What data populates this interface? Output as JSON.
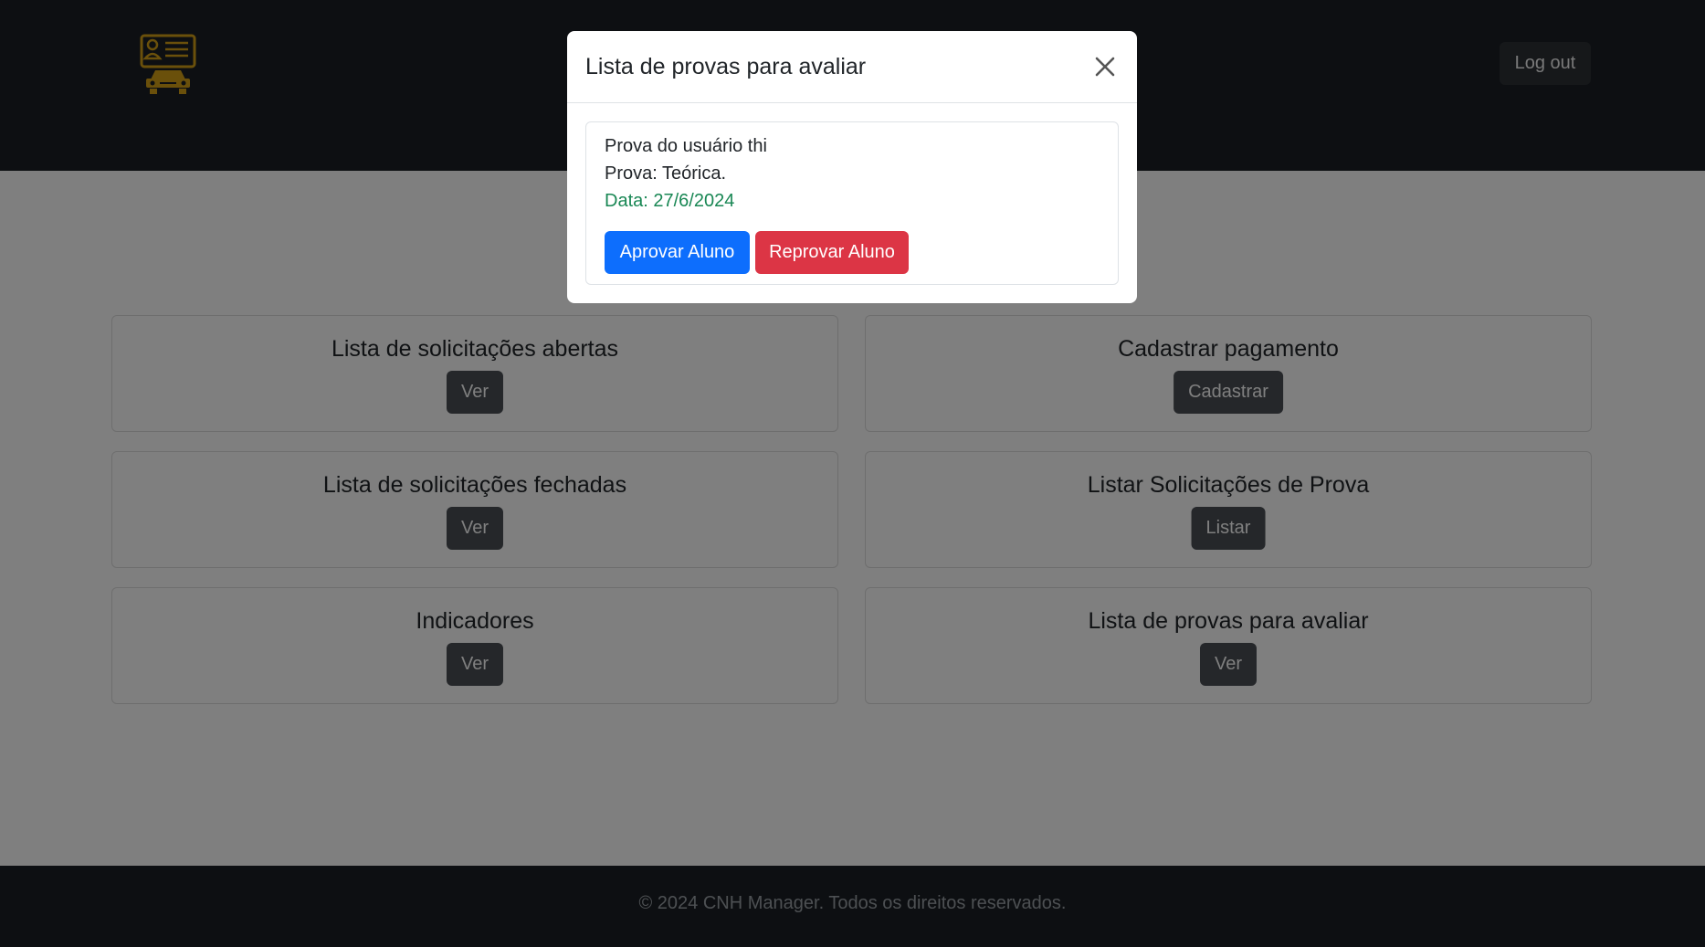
{
  "header": {
    "logo_icon": "id-card-car-icon",
    "logout_label": "Log out"
  },
  "cards": [
    {
      "title": "Lista de solicitações abertas",
      "button": "Ver"
    },
    {
      "title": "Cadastrar pagamento",
      "button": "Cadastrar"
    },
    {
      "title": "Lista de solicitações fechadas",
      "button": "Ver"
    },
    {
      "title": "Listar Solicitações de Prova",
      "button": "Listar"
    },
    {
      "title": "Indicadores",
      "button": "Ver"
    },
    {
      "title": "Lista de provas para avaliar",
      "button": "Ver"
    }
  ],
  "footer": {
    "text": "© 2024 CNH Manager. Todos os direitos reservados."
  },
  "modal": {
    "title": "Lista de provas para avaliar",
    "close_icon": "close-icon",
    "exam": {
      "user_line": "Prova do usuário thi",
      "type_line": "Prova: Teórica.",
      "date_line": "Data: 27/6/2024",
      "approve_label": "Aprovar Aluno",
      "reject_label": "Reprovar Aluno"
    }
  },
  "colors": {
    "header_bg": "#1b1f24",
    "logo": "#d4a017",
    "primary": "#0d6efd",
    "danger": "#dc3545",
    "success": "#198754",
    "secondary_btn": "#4a4f55"
  }
}
